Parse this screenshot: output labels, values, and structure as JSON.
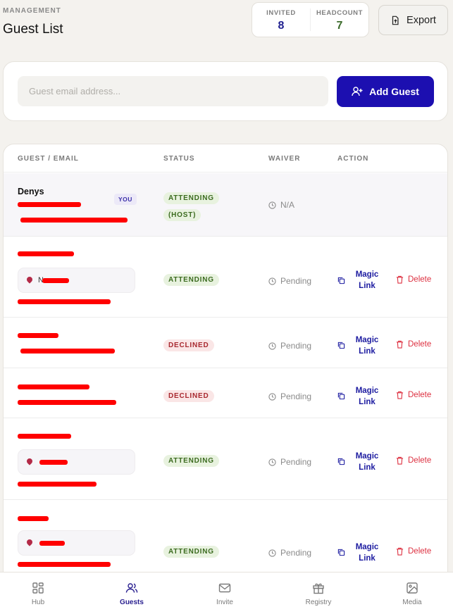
{
  "header": {
    "eyebrow": "MANAGEMENT",
    "title": "Guest List"
  },
  "stats": {
    "invited_label": "INVITED",
    "invited_value": "8",
    "headcount_label": "HEADCOUNT",
    "headcount_value": "7"
  },
  "toolbar": {
    "export_label": "Export",
    "add_guest_label": "Add Guest"
  },
  "add_form": {
    "email_placeholder": "Guest email address..."
  },
  "table": {
    "columns": [
      "GUEST / EMAIL",
      "STATUS",
      "WAIVER",
      "ACTION"
    ],
    "you_badge": "YOU",
    "magic_link_line1": "Magic",
    "magic_link_line2": "Link",
    "delete_label": "Delete",
    "rows": [
      {
        "name_visible": "Denys",
        "status": "ATTENDING",
        "status_extra": "(HOST)",
        "waiver": "N/A"
      },
      {
        "status": "ATTENDING",
        "waiver": "Pending",
        "note_visible": "N"
      },
      {
        "status": "DECLINED",
        "waiver": "Pending"
      },
      {
        "status": "DECLINED",
        "waiver": "Pending"
      },
      {
        "status": "ATTENDING",
        "waiver": "Pending"
      },
      {
        "status": "ATTENDING",
        "waiver": "Pending"
      }
    ]
  },
  "nav": {
    "items": [
      {
        "label": "Hub",
        "icon": "grid-icon"
      },
      {
        "label": "Guests",
        "icon": "users-icon",
        "active": true
      },
      {
        "label": "Invite",
        "icon": "mail-icon"
      },
      {
        "label": "Registry",
        "icon": "gift-icon"
      },
      {
        "label": "Media",
        "icon": "image-icon"
      }
    ]
  },
  "colors": {
    "primary": "#1c0fb0",
    "attending_bg": "#e8f2df",
    "declined_bg": "#fae6e6",
    "delete": "#dd3040"
  }
}
